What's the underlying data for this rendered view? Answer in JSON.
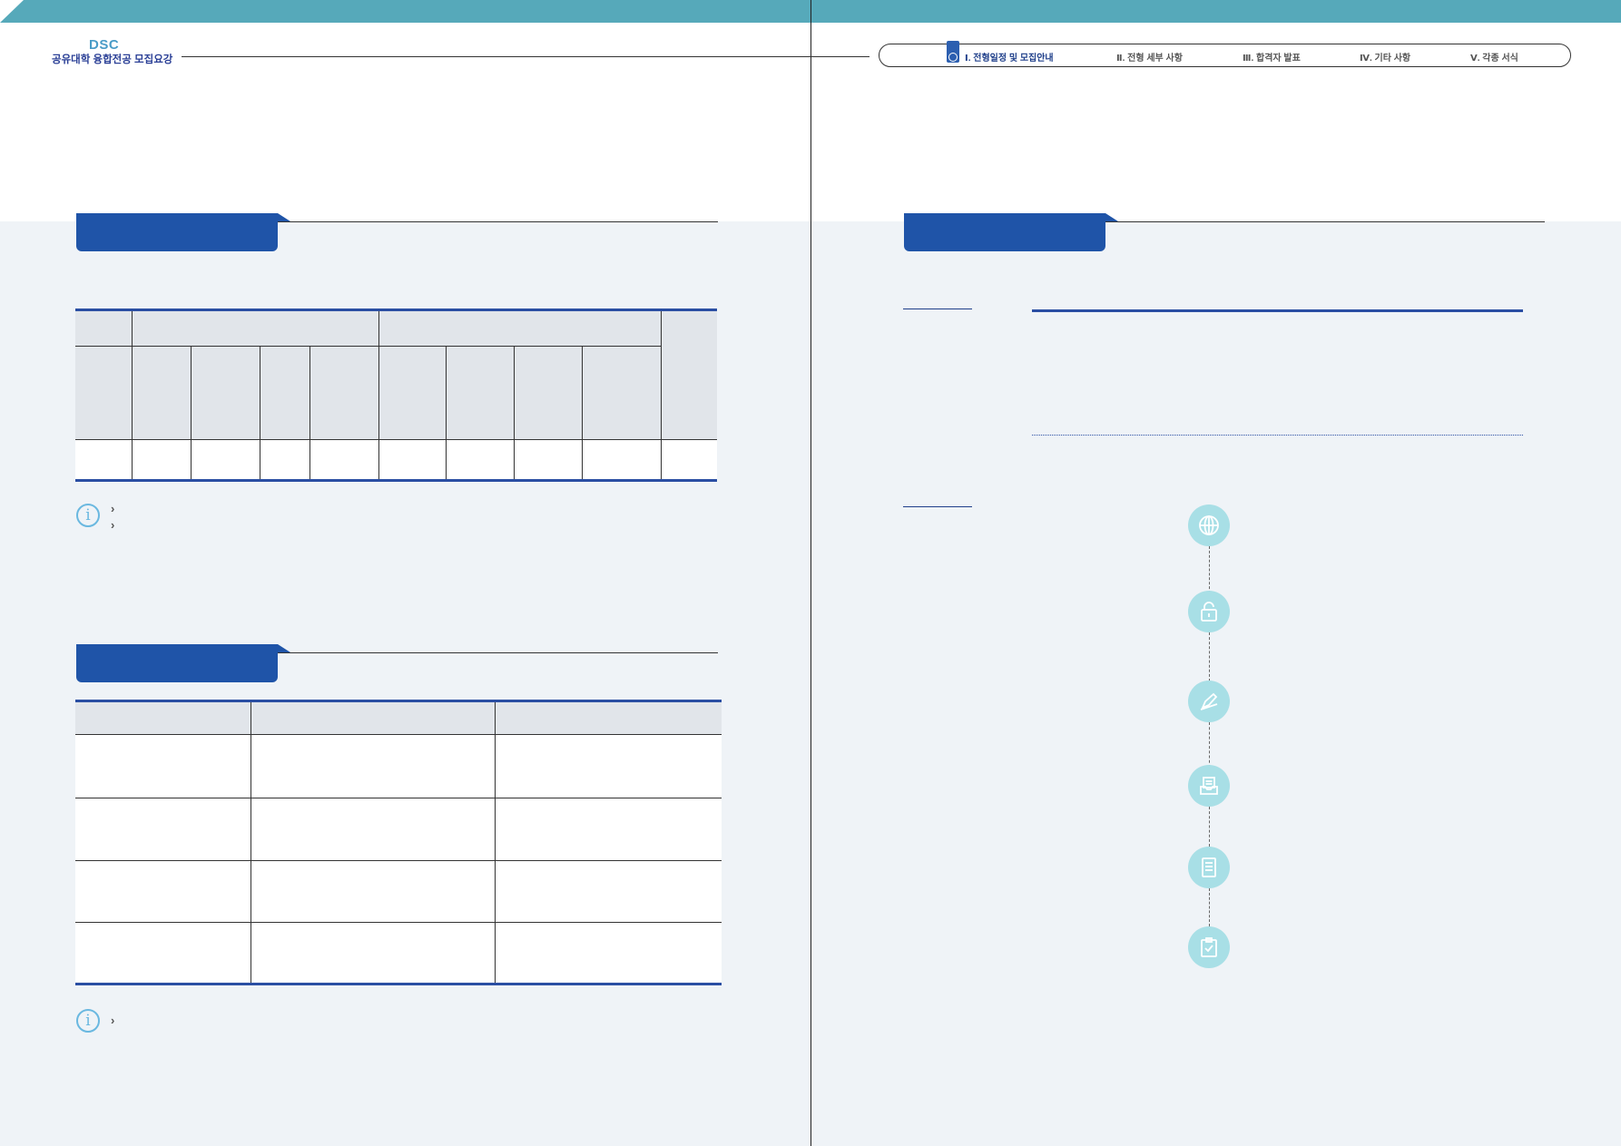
{
  "header": {
    "logo": "DSC",
    "subtitle": "공유대학 융합전공 모집요강"
  },
  "nav": {
    "items": [
      {
        "label": "Ⅰ. 전형일정 및 모집안내",
        "active": true
      },
      {
        "label": "Ⅱ. 전형 세부 사항",
        "active": false
      },
      {
        "label": "Ⅲ. 합격자 발표",
        "active": false
      },
      {
        "label": "Ⅳ. 기타 사항",
        "active": false
      },
      {
        "label": "Ⅴ. 각종 서식",
        "active": false
      }
    ]
  },
  "left_page": {
    "info_note_1": {
      "chevron": "›",
      "lines": 2
    },
    "info_note_2": {
      "chevron": "›",
      "lines": 1
    }
  },
  "right_page": {
    "steps": [
      {
        "icon": "globe-icon"
      },
      {
        "icon": "unlock-icon"
      },
      {
        "icon": "pen-icon"
      },
      {
        "icon": "inbox-document-icon"
      },
      {
        "icon": "document-icon"
      },
      {
        "icon": "clipboard-check-icon"
      }
    ]
  },
  "colors": {
    "top_bar": "#56a9ba",
    "section_tab": "#1f54a8",
    "table_rule": "#2a4ea3",
    "background": "#eff3f7",
    "step_circle": "#a8dfe6",
    "info_icon": "#6ab8e0"
  }
}
